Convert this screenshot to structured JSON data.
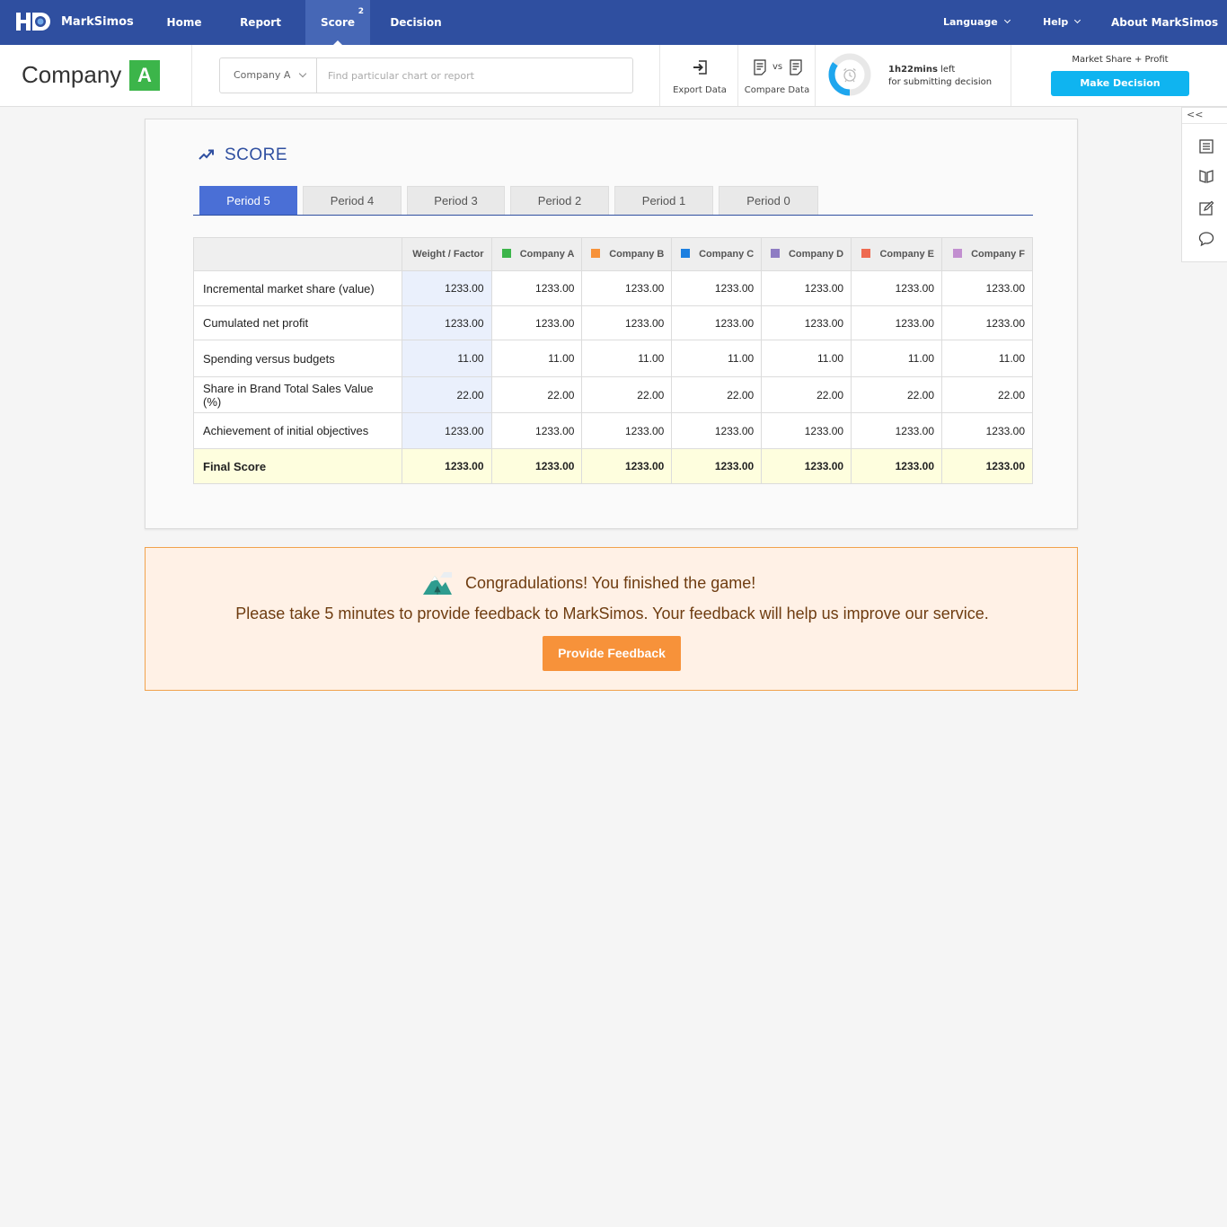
{
  "app": {
    "name": "MarkSimos",
    "nav": [
      {
        "label": "Home"
      },
      {
        "label": "Report"
      },
      {
        "label": "Score",
        "badge": "2"
      },
      {
        "label": "Decision"
      }
    ],
    "right_nav": {
      "language": "Language",
      "help": "Help",
      "about": "About MarkSimos"
    },
    "colors": {
      "nav_bg": "#2f4fa0",
      "accent": "#4a6fd6",
      "decision": "#0fb4f0",
      "feedback": "#f7923a"
    }
  },
  "subheader": {
    "company_title": "Company",
    "company_letter": "A",
    "company_select": "Company A",
    "search_placeholder": "Find particular chart or report",
    "export_label": "Export Data",
    "compare_label": "Compare Data",
    "compare_vs": "vs",
    "timer_value": "1h22mins",
    "timer_suffix": "left",
    "timer_sub": "for submitting decision",
    "timer_progress": 0.35,
    "goal_label": "Market Share + Profit",
    "make_decision": "Make Decision"
  },
  "sidebar": {
    "collapse": "<<",
    "icons": [
      "list-icon",
      "book-icon",
      "edit-icon",
      "chat-icon"
    ]
  },
  "score": {
    "title": "SCORE",
    "tabs": [
      {
        "label": "Period 5",
        "active": true
      },
      {
        "label": "Period 4"
      },
      {
        "label": "Period 3"
      },
      {
        "label": "Period 2"
      },
      {
        "label": "Period 1"
      },
      {
        "label": "Period 0"
      }
    ],
    "columns": [
      {
        "label": "Weight / Factor"
      },
      {
        "label": "Company A",
        "color": "#3cb54a"
      },
      {
        "label": "Company B",
        "color": "#f7923a"
      },
      {
        "label": "Company C",
        "color": "#1c7fe0"
      },
      {
        "label": "Company D",
        "color": "#8e7cc3"
      },
      {
        "label": "Company E",
        "color": "#ee6a50"
      },
      {
        "label": "Company F",
        "color": "#c28fd0"
      }
    ],
    "rows": [
      {
        "label": "Incremental market share (value)",
        "values": [
          "1233.00",
          "1233.00",
          "1233.00",
          "1233.00",
          "1233.00",
          "1233.00",
          "1233.00"
        ]
      },
      {
        "label": "Cumulated net profit",
        "values": [
          "1233.00",
          "1233.00",
          "1233.00",
          "1233.00",
          "1233.00",
          "1233.00",
          "1233.00"
        ]
      },
      {
        "label": "Spending versus budgets",
        "values": [
          "11.00",
          "11.00",
          "11.00",
          "11.00",
          "11.00",
          "11.00",
          "11.00"
        ]
      },
      {
        "label": "Share in Brand Total Sales Value (%)",
        "values": [
          "22.00",
          "22.00",
          "22.00",
          "22.00",
          "22.00",
          "22.00",
          "22.00"
        ]
      },
      {
        "label": "Achievement of initial objectives",
        "values": [
          "1233.00",
          "1233.00",
          "1233.00",
          "1233.00",
          "1233.00",
          "1233.00",
          "1233.00"
        ]
      }
    ],
    "final": {
      "label": "Final Score",
      "values": [
        "1233.00",
        "1233.00",
        "1233.00",
        "1233.00",
        "1233.00",
        "1233.00",
        "1233.00"
      ]
    }
  },
  "congrats": {
    "title": "Congradulations! You finished the game!",
    "message": "Please take 5 minutes to provide feedback to MarkSimos. Your feedback will help us improve our service.",
    "button": "Provide Feedback"
  }
}
